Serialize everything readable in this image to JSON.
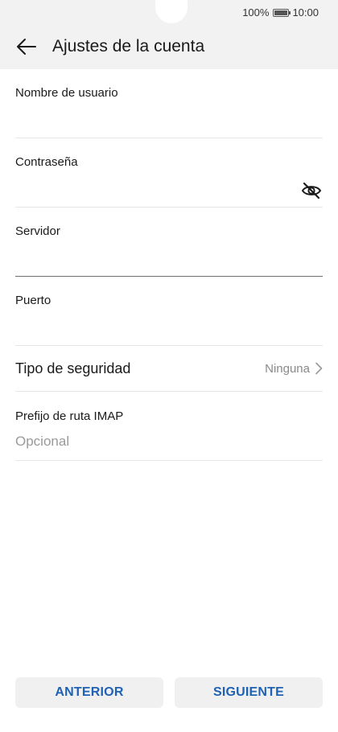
{
  "status": {
    "battery": "100%",
    "time": "10:00"
  },
  "header": {
    "title": "Ajustes de la cuenta"
  },
  "form": {
    "username": {
      "label": "Nombre de usuario",
      "value": ""
    },
    "password": {
      "label": "Contraseña",
      "value": ""
    },
    "server": {
      "label": "Servidor",
      "value": ""
    },
    "port": {
      "label": "Puerto",
      "value": ""
    },
    "security": {
      "label": "Tipo de seguridad",
      "value": "Ninguna"
    },
    "imap_prefix": {
      "label": "Prefijo de ruta IMAP",
      "placeholder": "Opcional",
      "value": ""
    }
  },
  "buttons": {
    "previous": "ANTERIOR",
    "next": "SIGUIENTE"
  },
  "icons": {
    "back": "arrow-left-icon",
    "password_toggle": "eye-off-icon",
    "chevron": "chevron-right-icon",
    "battery": "battery-icon"
  },
  "colors": {
    "accent": "#1f62b4",
    "header_bg": "#f2f2f2"
  }
}
